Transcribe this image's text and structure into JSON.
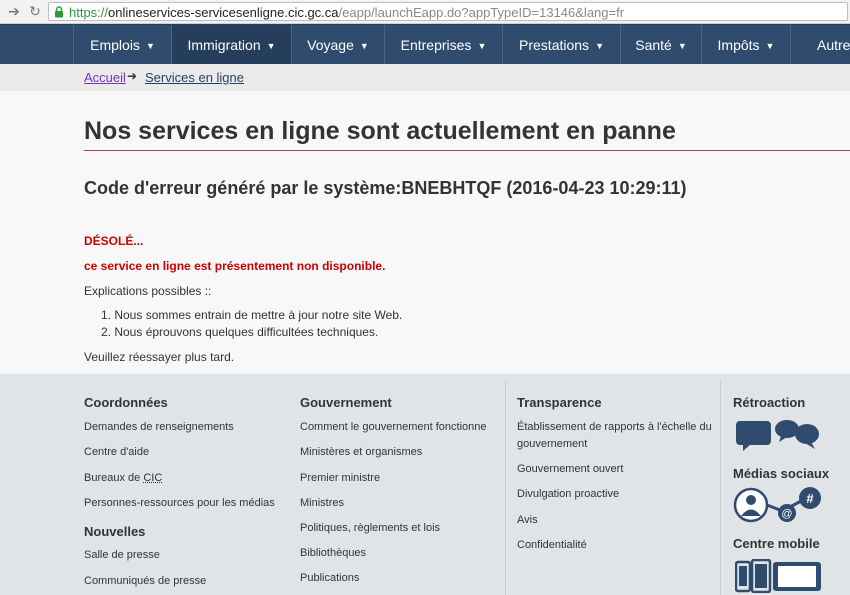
{
  "browser": {
    "url_scheme": "https://",
    "url_host": "onlineservices-servicesenligne.cic.gc.ca",
    "url_path": "/eapp/launchEapp.do?appTypeID=13146&lang=fr"
  },
  "menu": {
    "items": [
      {
        "label": "Emplois"
      },
      {
        "label": "Immigration"
      },
      {
        "label": "Voyage"
      },
      {
        "label": "Entreprises"
      },
      {
        "label": "Prestations"
      },
      {
        "label": "Santé"
      },
      {
        "label": "Impôts"
      },
      {
        "label": "Autres"
      }
    ]
  },
  "breadcrumb": {
    "home": "Accueil",
    "current": "Services en ligne"
  },
  "main": {
    "title": "Nos services en ligne sont actuellement en panne",
    "error_code": "Code d'erreur généré par le système:BNEBHTQF (2016-04-23 10:29:11)",
    "sorry": "DÉSOLÉ...",
    "unavailable": "ce service en ligne est présentement non disponible.",
    "explanations_label": "Explications possibles ::",
    "explanations": [
      "1. Nous sommes entrain de mettre à jour notre site Web.",
      "2. Nous éprouvons quelques difficultées techniques."
    ],
    "retry": "Veuillez réessayer plus tard."
  },
  "footer": {
    "coordonnees": {
      "heading": "Coordonnées",
      "links": [
        "Demandes de renseignements",
        "Centre d'aide",
        "Bureaux de ",
        "Personnes-ressources pour les médias"
      ],
      "cic": "CIC"
    },
    "nouvelles": {
      "heading": "Nouvelles",
      "links": [
        "Salle de presse",
        "Communiqués de presse"
      ]
    },
    "gouvernement": {
      "heading": "Gouvernement",
      "links": [
        "Comment le gouvernement fonctionne",
        "Ministères et organismes",
        "Premier ministre",
        "Ministres",
        "Politiques, règlements et lois",
        "Bibliothèques",
        "Publications"
      ]
    },
    "transparence": {
      "heading": "Transparence",
      "links_line1": "Établissement de rapports à l'échelle du",
      "links_line2": "gouvernement",
      "links": [
        "Gouvernement ouvert",
        "Divulgation proactive",
        "Avis",
        "Confidentialité"
      ]
    },
    "retroaction": {
      "heading": "Rétroaction",
      "icon": "feedback-bubbles-icon"
    },
    "medias": {
      "heading": "Médias sociaux",
      "icon": "social-network-icon"
    },
    "mobile": {
      "heading": "Centre mobile",
      "icon": "mobile-devices-icon"
    }
  },
  "colors": {
    "menu_bg": "#2f4b6e",
    "menu_active": "#253e5c",
    "error_red": "#c00000",
    "title_rule": "#af3c43",
    "footer_bg": "#e1e4e7",
    "icon_blue": "#2f4b6e"
  }
}
